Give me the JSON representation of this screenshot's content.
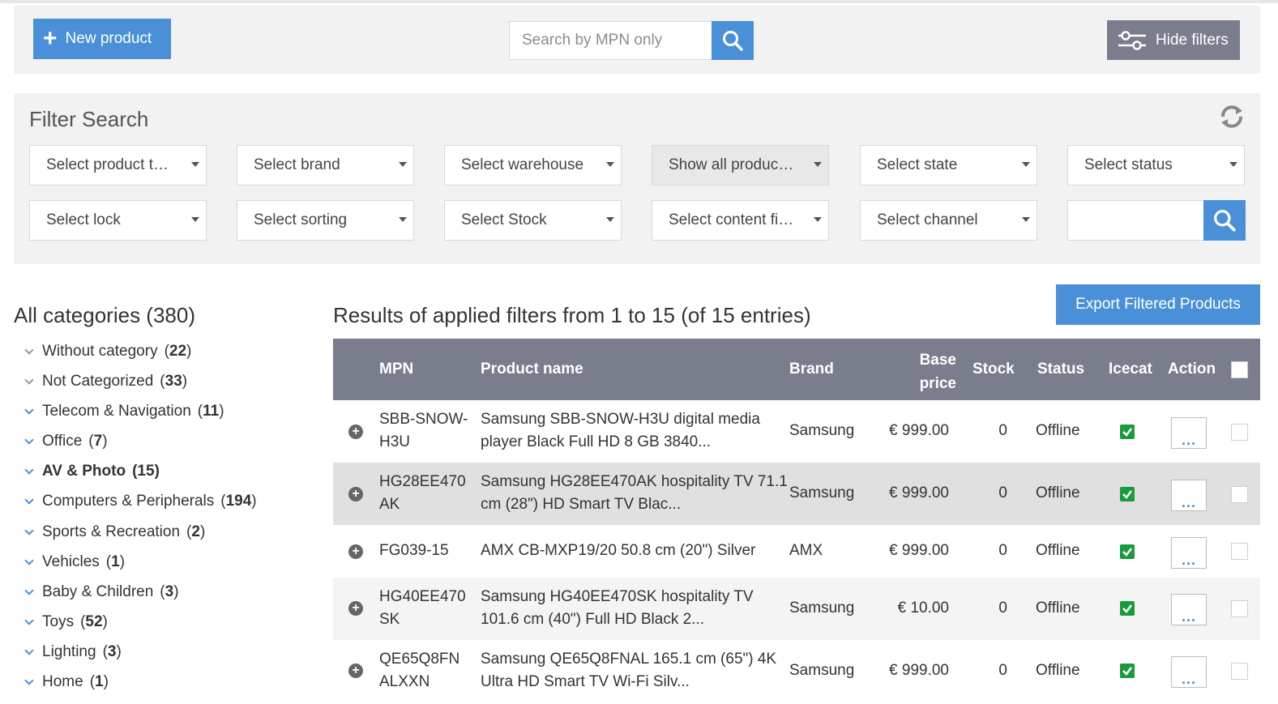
{
  "toolbar": {
    "new_product_label": "New product",
    "search_placeholder": "Search by MPN only",
    "hide_filters_label": "Hide filters"
  },
  "filters": {
    "title": "Filter Search",
    "row1": [
      "Select product t…",
      "Select brand",
      "Select warehouse",
      "Show all produc…",
      "Select state",
      "Select status"
    ],
    "row2": [
      "Select lock",
      "Select sorting",
      "Select Stock",
      "Select content fi…",
      "Select channel"
    ],
    "search_value": ""
  },
  "categories": {
    "title": "All categories (380)",
    "items": [
      {
        "name": "Without category",
        "count": "22"
      },
      {
        "name": "Not Categorized",
        "count": "33"
      },
      {
        "name": "Telecom & Navigation",
        "count": "11"
      },
      {
        "name": "Office",
        "count": "7"
      },
      {
        "name": "AV & Photo",
        "count": "15"
      },
      {
        "name": "Computers & Peripherals",
        "count": "194"
      },
      {
        "name": "Sports & Recreation",
        "count": "2"
      },
      {
        "name": "Vehicles",
        "count": "1"
      },
      {
        "name": "Baby & Children",
        "count": "3"
      },
      {
        "name": "Toys",
        "count": "52"
      },
      {
        "name": "Lighting",
        "count": "3"
      },
      {
        "name": "Home",
        "count": "1"
      }
    ]
  },
  "results": {
    "title": "Results of applied filters from 1 to 15 (of 15 entries)",
    "export_label": "Export Filtered Products",
    "columns": {
      "mpn": "MPN",
      "name": "Product name",
      "brand": "Brand",
      "price_line1": "Base",
      "price_line2": "price",
      "stock": "Stock",
      "status": "Status",
      "icecat": "Icecat",
      "action": "Action"
    },
    "rows": [
      {
        "mpn1": "SBB-SNOW-",
        "mpn2": "H3U",
        "name1": "Samsung SBB-SNOW-H3U digital media",
        "name2": "player Black Full HD 8 GB 3840...",
        "brand": "Samsung",
        "price": "€ 999.00",
        "stock": "0",
        "status": "Offline",
        "action": "..."
      },
      {
        "mpn1": "HG28EE470",
        "mpn2": "AK",
        "name1": "Samsung HG28EE470AK hospitality TV 71.1",
        "name2": "cm (28\") HD Smart TV Blac...",
        "brand": "Samsung",
        "price": "€ 999.00",
        "stock": "0",
        "status": "Offline",
        "action": "..."
      },
      {
        "mpn1": "FG039-15",
        "mpn2": "",
        "name1": "AMX CB-MXP19/20 50.8 cm (20\") Silver",
        "name2": "",
        "brand": "AMX",
        "price": "€ 999.00",
        "stock": "0",
        "status": "Offline",
        "action": "..."
      },
      {
        "mpn1": "HG40EE470",
        "mpn2": "SK",
        "name1": "Samsung HG40EE470SK hospitality TV",
        "name2": "101.6 cm (40\") Full HD Black 2...",
        "brand": "Samsung",
        "price": "€ 10.00",
        "stock": "0",
        "status": "Offline",
        "action": "..."
      },
      {
        "mpn1": "QE65Q8FN",
        "mpn2": "ALXXN",
        "name1": "Samsung QE65Q8FNAL 165.1 cm (65\") 4K",
        "name2": "Ultra HD Smart TV Wi-Fi Silv...",
        "brand": "Samsung",
        "price": "€ 999.00",
        "stock": "0",
        "status": "Offline",
        "action": "..."
      }
    ]
  },
  "colors": {
    "accent": "#4a90d9",
    "header_bg": "#7a7d8c",
    "icecat_check": "#1a9c3e"
  }
}
